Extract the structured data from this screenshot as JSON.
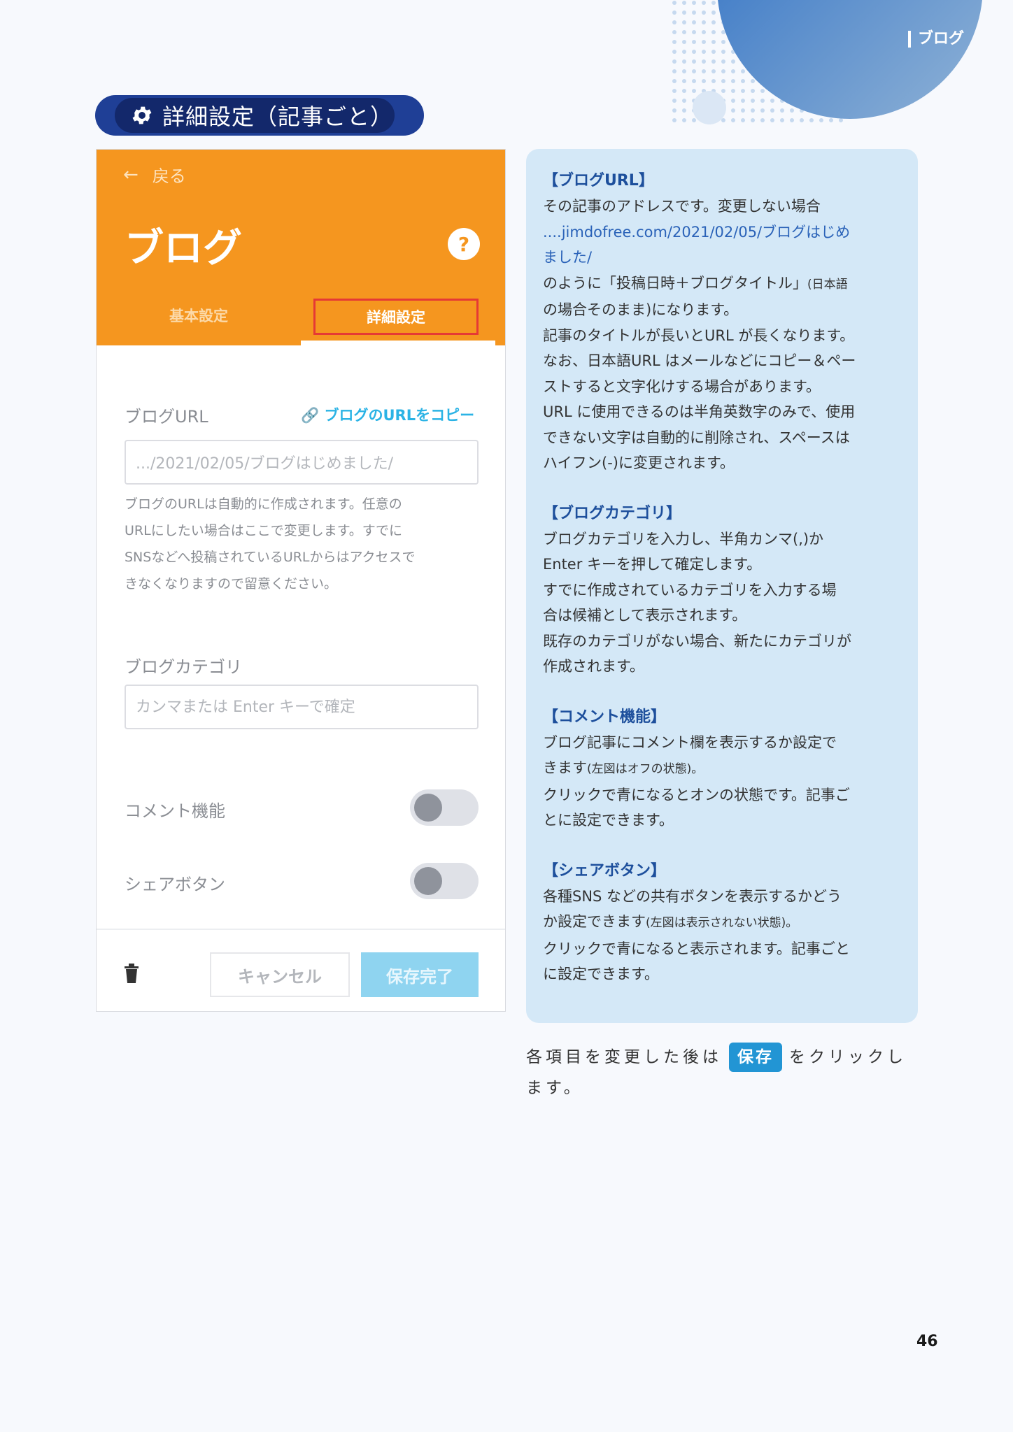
{
  "header": {
    "section_label": "ブログ"
  },
  "heading": {
    "title": "詳細設定（記事ごと）"
  },
  "panel": {
    "back_label": "戻る",
    "title": "ブログ",
    "help_icon": "?",
    "tabs": [
      {
        "label": "基本設定"
      },
      {
        "label": "詳細設定"
      }
    ],
    "blog_url_label": "ブログURL",
    "copy_link": "ブログのURLをコピー",
    "url_value": ".../2021/02/05/ブログはじめました/",
    "url_note": [
      "ブログのURLは自動的に作成されます。任意の",
      "URLにしたい場合はここで変更します。すでに",
      "SNSなどへ投稿されているURLからはアクセスで",
      "きなくなりますので留意ください。"
    ],
    "category_label": "ブログカテゴリ",
    "category_placeholder": "カンマまたは Enter キーで確定",
    "comment_label": "コメント機能",
    "comment_on": false,
    "share_label": "シェアボタン",
    "share_on": false,
    "cancel_button": "キャンセル",
    "save_button": "保存完了"
  },
  "explain": {
    "blog_url": {
      "heading": "【ブログURL】",
      "lines": [
        "その記事のアドレスです。変更しない場合",
        "....jimdofree.com/2021/02/05/ブログはじめ",
        "ました/",
        "のように「投稿日時＋ブログタイトル」",
        "(日本語",
        "の場合そのまま)になります。",
        "記事のタイトルが長いとURL が長くなります。",
        "なお、日本語URL はメールなどにコピー＆ペー",
        "ストすると文字化けする場合があります。",
        "URL に使用できるのは半角英数字のみで、使用",
        "できない文字は自動的に削除され、スペースは",
        "ハイフン(-)に変更されます。"
      ]
    },
    "category": {
      "heading": "【ブログカテゴリ】",
      "lines": [
        "ブログカテゴリを入力し、半角カンマ(,)か",
        "Enter キーを押して確定します。",
        "すでに作成されているカテゴリを入力する場",
        "合は候補として表示されます。",
        "既存のカテゴリがない場合、新たにカテゴリが",
        "作成されます。"
      ]
    },
    "comment": {
      "heading": "【コメント機能】",
      "lines": [
        "ブログ記事にコメント欄を表示するか設定で",
        "きます",
        "(左図はオフの状態)。",
        "クリックで青になるとオンの状態です。記事ご",
        "とに設定できます。"
      ]
    },
    "share": {
      "heading": "【シェアボタン】",
      "lines": [
        "各種SNS などの共有ボタンを表示するかどう",
        "か設定できます",
        "(左図は表示されない状態)。",
        "クリックで青になると表示されます。記事ごと",
        "に設定できます。"
      ]
    }
  },
  "bottom": {
    "before": "各項目を変更した後は",
    "chip": "保存",
    "after": "をクリックし",
    "line2": "ます。"
  },
  "page_number": "46",
  "colors": {
    "orange": "#f5961f",
    "navy": "#13286b",
    "light_blue": "#d4e8f7",
    "accent_blue": "#2295d4"
  }
}
